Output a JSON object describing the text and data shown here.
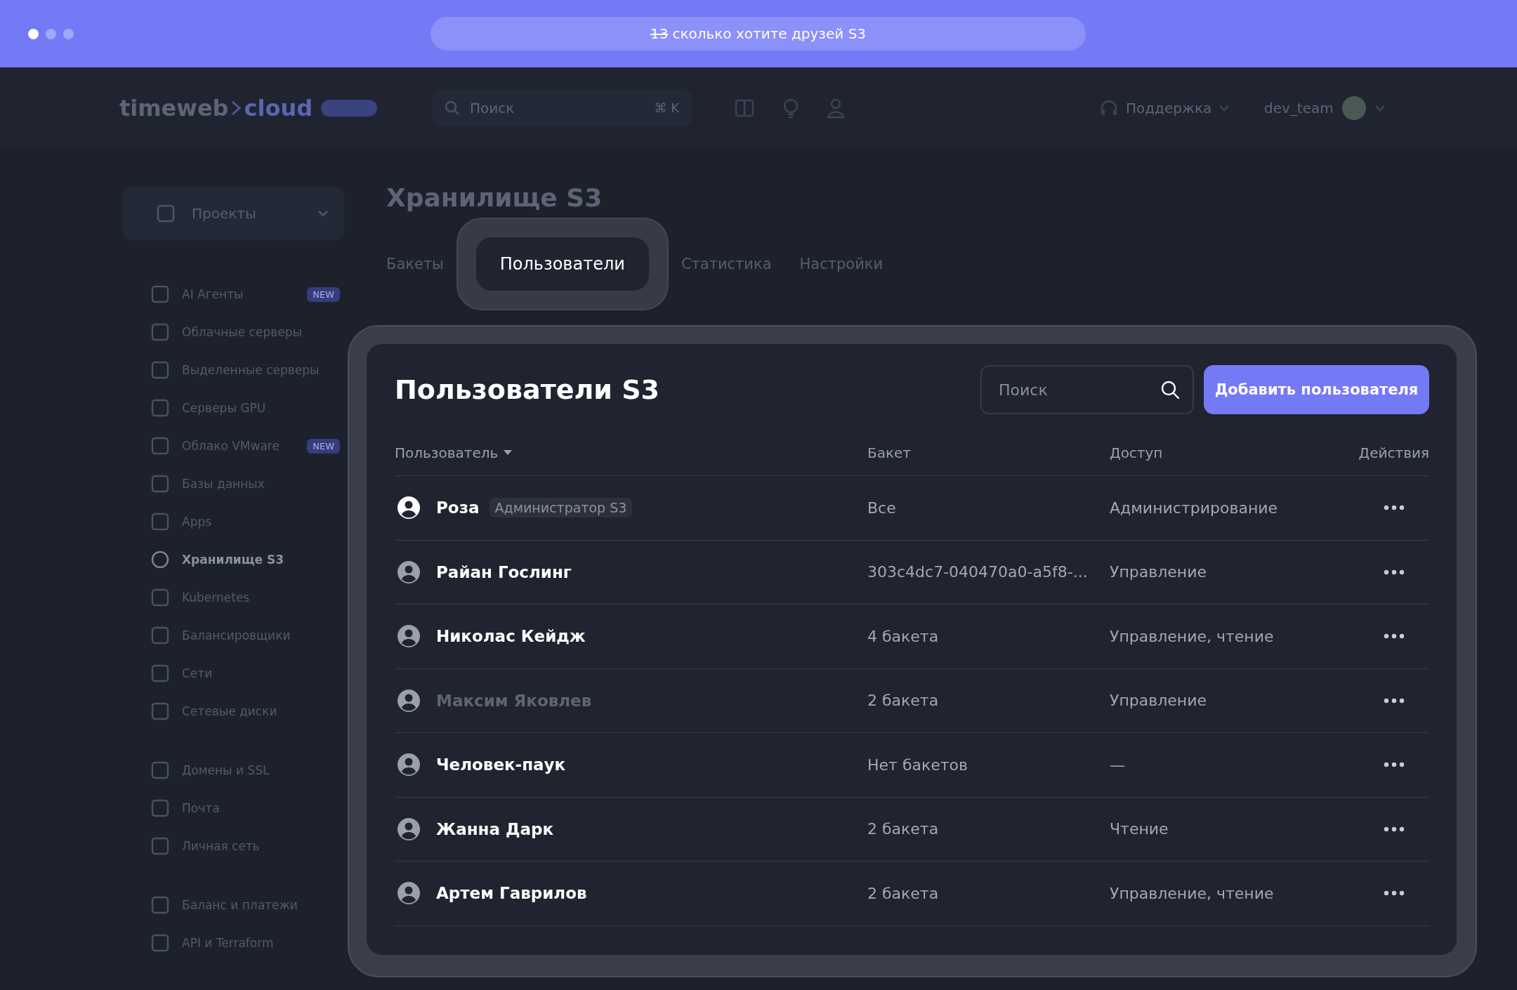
{
  "top_bar": {
    "address_struck": "13",
    "address": "сколько хотите друзей S3"
  },
  "header": {
    "logo": "timeweb",
    "logo_accent": "cloud",
    "search": {
      "placeholder": "Поиск",
      "shortcut": "⌘ K"
    },
    "support": "Поддержка",
    "account": "dev_team"
  },
  "sidebar": {
    "project": "Проекты",
    "groups": [
      [
        {
          "label": "AI Агенты",
          "badge": "NEW",
          "selected": false
        },
        {
          "label": "Облачные серверы",
          "selected": false
        },
        {
          "label": "Выделенные серверы",
          "selected": false
        },
        {
          "label": "Серверы GPU",
          "selected": false
        },
        {
          "label": "Облако VMware",
          "badge": "NEW",
          "selected": false
        },
        {
          "label": "Базы данных",
          "selected": false
        },
        {
          "label": "Apps",
          "selected": false
        },
        {
          "label": "Хранилище S3",
          "selected": true
        },
        {
          "label": "Kubernetes",
          "selected": false
        },
        {
          "label": "Балансировщики",
          "selected": false
        },
        {
          "label": "Сети",
          "selected": false
        },
        {
          "label": "Сетевые диски",
          "selected": false
        }
      ],
      [
        {
          "label": "Домены и SSL",
          "selected": false
        },
        {
          "label": "Почта",
          "selected": false
        },
        {
          "label": "Личная сеть",
          "selected": false
        }
      ],
      [
        {
          "label": "Баланс и платежи",
          "selected": false
        },
        {
          "label": "API и Terraform",
          "selected": false
        }
      ]
    ]
  },
  "page": {
    "title": "Хранилище S3",
    "tabs": [
      {
        "label": "Бакеты",
        "selected": false
      },
      {
        "label": "Пользователи",
        "selected": true
      },
      {
        "label": "Статистика",
        "selected": false
      },
      {
        "label": "Настройки",
        "selected": false
      }
    ]
  },
  "users_card": {
    "title": "Пользователи S3",
    "search": {
      "placeholder": "Поиск"
    },
    "add_button": "Добавить пользователя",
    "columns": [
      {
        "label": "Пользователь",
        "sorted": true
      },
      {
        "label": "Бакет",
        "sorted": false
      },
      {
        "label": "Доступ",
        "sorted": false
      },
      {
        "label": "Действия",
        "sorted": false
      }
    ],
    "rows": [
      {
        "name": "Роза",
        "role": "Администратор S3",
        "bucket": "Все",
        "access": "Администрирование",
        "current": true,
        "disabled": false
      },
      {
        "name": "Райан Гослинг",
        "bucket": "303c4dc7-040470a0-a5f8-...",
        "access": "Управление",
        "current": false,
        "disabled": false
      },
      {
        "name": "Николас Кейдж",
        "bucket": "4 бакета",
        "access": "Управление, чтение",
        "current": false,
        "disabled": false
      },
      {
        "name": "Максим Яковлев",
        "bucket": "2 бакета",
        "access": "Управление",
        "current": false,
        "disabled": true
      },
      {
        "name": "Человек-паук",
        "bucket": "Нет бакетов",
        "access": "—",
        "current": false,
        "disabled": false
      },
      {
        "name": "Жанна Дарк",
        "bucket": "2 бакета",
        "access": "Чтение",
        "current": false,
        "disabled": false
      },
      {
        "name": "Артем Гаврилов",
        "bucket": "2 бакета",
        "access": "Управление, чтение",
        "current": false,
        "disabled": false
      }
    ]
  }
}
